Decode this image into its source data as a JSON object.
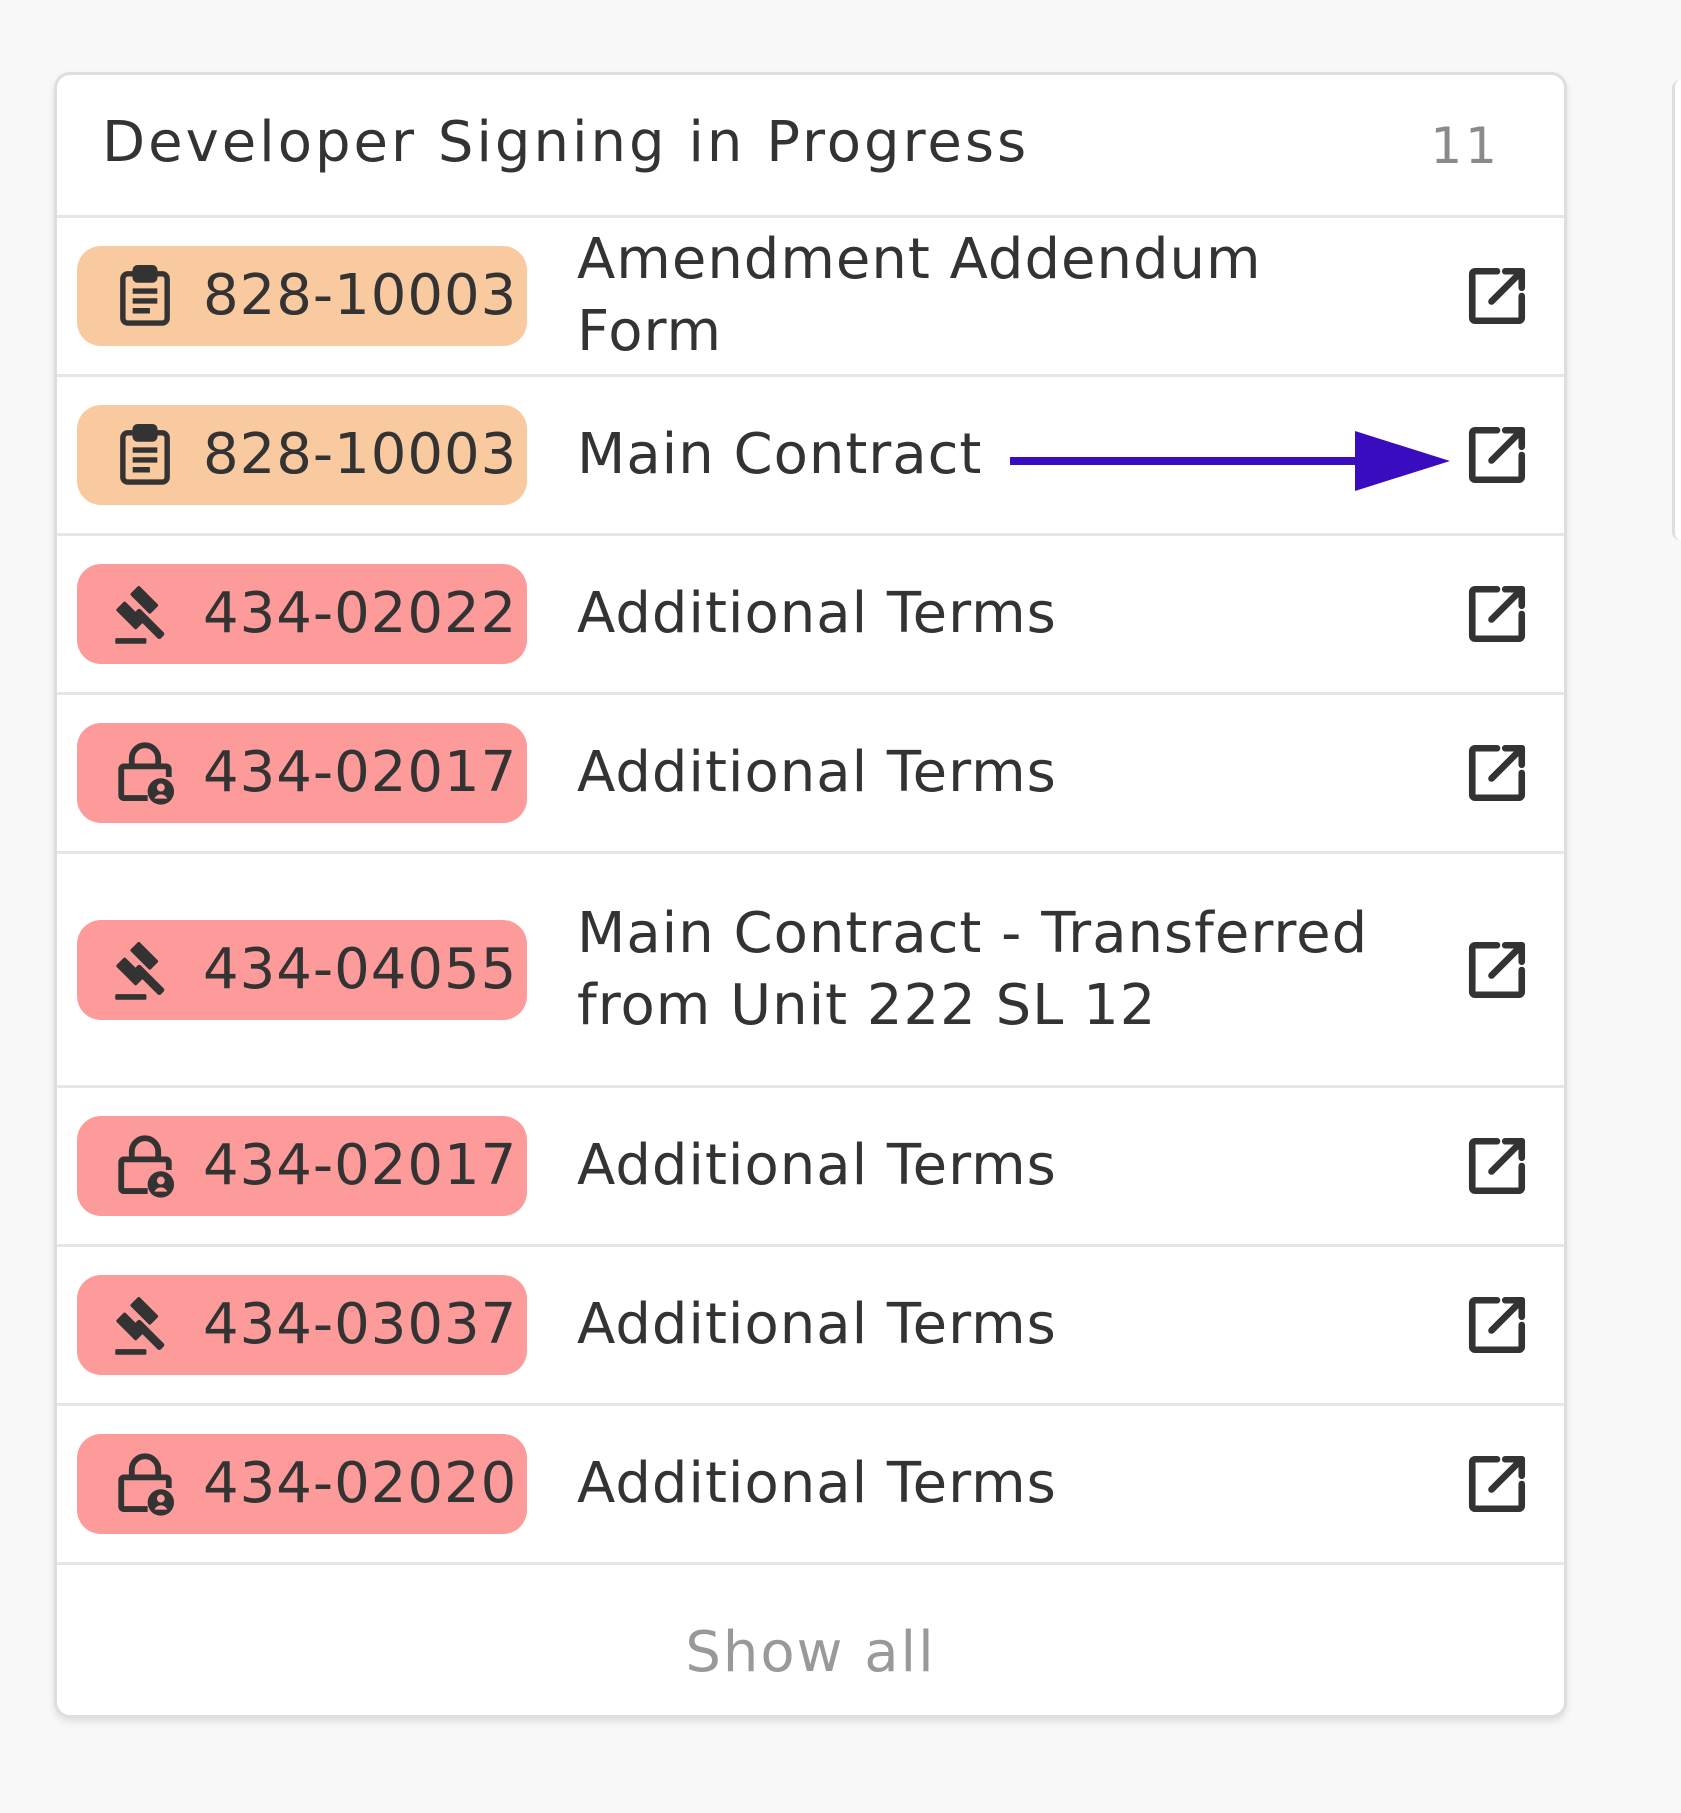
{
  "panel": {
    "title": "Developer Signing in Progress",
    "count": "11",
    "show_all": "Show all"
  },
  "rows": [
    {
      "code": "828-10003",
      "label": "Amendment Addendum Form",
      "badge_color": "#f9c9a0",
      "icon": "clipboard-icon"
    },
    {
      "code": "828-10003",
      "label": "Main Contract",
      "badge_color": "#f9c9a0",
      "icon": "clipboard-icon"
    },
    {
      "code": "434-02022",
      "label": "Additional Terms",
      "badge_color": "#fd9a9a",
      "icon": "gavel-icon"
    },
    {
      "code": "434-02017",
      "label": "Additional Terms",
      "badge_color": "#fd9a9a",
      "icon": "lock-person-icon"
    },
    {
      "code": "434-04055",
      "label": "Main Contract - Transferred from Unit 222 SL 12",
      "badge_color": "#fd9a9a",
      "icon": "gavel-icon"
    },
    {
      "code": "434-02017",
      "label": "Additional Terms",
      "badge_color": "#fd9a9a",
      "icon": "lock-person-icon"
    },
    {
      "code": "434-03037",
      "label": "Additional Terms",
      "badge_color": "#fd9a9a",
      "icon": "gavel-icon"
    },
    {
      "code": "434-02020",
      "label": "Additional Terms",
      "badge_color": "#fd9a9a",
      "icon": "lock-person-icon"
    }
  ],
  "annotation": {
    "arrow_color": "#3a0cc0",
    "icon": "arrow-right-icon"
  }
}
